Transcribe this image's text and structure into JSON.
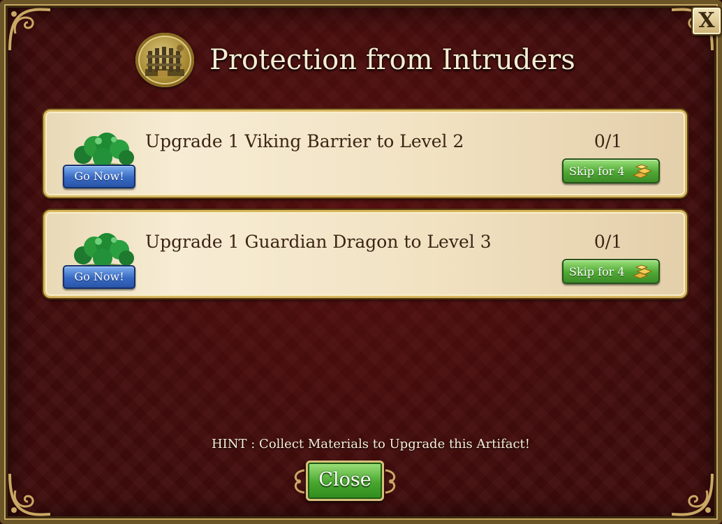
{
  "dialog": {
    "title": "Protection from Intruders",
    "close_x_label": "X",
    "quests": [
      {
        "description": "Upgrade 1 Viking Barrier to Level 2",
        "progress": "0/1",
        "go_label": "Go Now!",
        "skip_label": "Skip for 4",
        "skip_icon": "gold-bars-icon"
      },
      {
        "description": "Upgrade 1 Guardian Dragon to Level 3",
        "progress": "0/1",
        "go_label": "Go Now!",
        "skip_label": "Skip for 4",
        "skip_icon": "gold-bars-icon"
      }
    ],
    "hint": "HINT : Collect Materials to Upgrade this Artifact!",
    "close_label": "Close"
  },
  "colors": {
    "background": "#3f0b0b",
    "panel": "#f7ecd4",
    "go_button": "#3769c4",
    "skip_button": "#4fa833",
    "close_button": "#48a72e",
    "title_text": "#f6ecd2"
  }
}
